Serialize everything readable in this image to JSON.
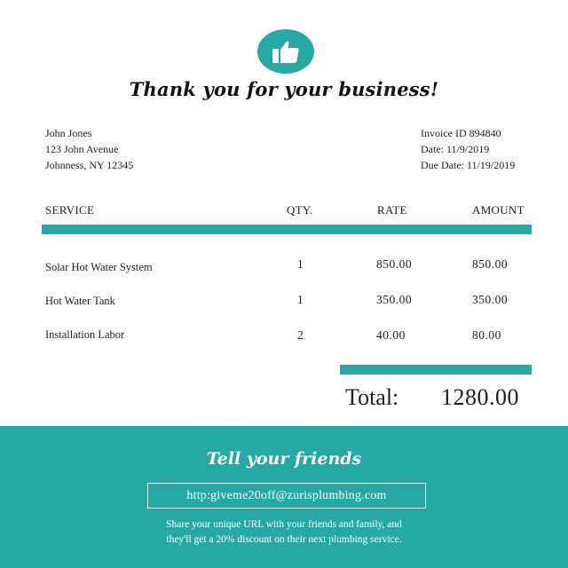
{
  "colors": {
    "accent": "#26a9a3",
    "text": "#1f1f1f",
    "background": "#ffffff"
  },
  "logo": {
    "icon": "thumbs-up-icon"
  },
  "title": "Thank you for your business!",
  "customer": {
    "name": "John Jones",
    "street": "123 John Avenue",
    "city": "Johnness, NY 12345"
  },
  "invoice": {
    "id": "Invoice ID 894840",
    "date": "Date: 11/9/2019",
    "due_date": "Due Date: 11/19/2019"
  },
  "table": {
    "headers": {
      "service": "SERVICE",
      "qty": "QTY.",
      "rate": "RATE",
      "amount": "AMOUNT"
    },
    "rows": [
      {
        "service": "Solar Hot Water System",
        "qty": "1",
        "rate": "850.00",
        "amount": "850.00"
      },
      {
        "service": "Hot Water Tank",
        "qty": "1",
        "rate": "350.00",
        "amount": "350.00"
      },
      {
        "service": "Installation Labor",
        "qty": "2",
        "rate": "40.00",
        "amount": "80.00"
      }
    ]
  },
  "total": {
    "label": "Total:",
    "value": "1280.00"
  },
  "footer": {
    "title": "Tell your friends",
    "url": "http:giveme20off@zurisplumbing.com",
    "text_line1": "Share your unique URL with your friends and family, and",
    "text_line2": "they'll get a 20% discount on their next plumbing service."
  }
}
